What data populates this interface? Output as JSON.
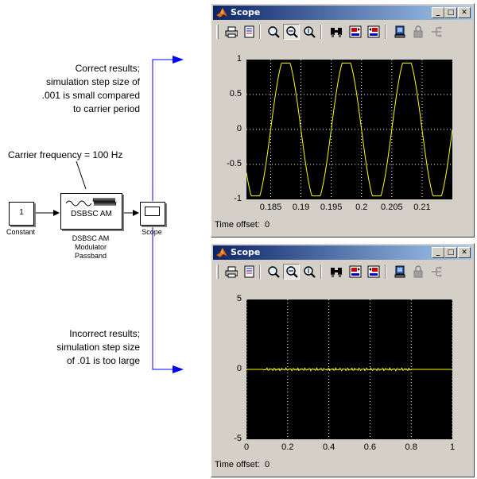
{
  "annotations": {
    "correct": [
      "Correct results;",
      "simulation step size of",
      ".001 is small compared",
      "to carrier period"
    ],
    "carrier": "Carrier frequency = 100 Hz",
    "incorrect": [
      "Incorrect results;",
      "simulation step size",
      "of .01 is too large"
    ]
  },
  "diagram": {
    "constant_value": "1",
    "constant_label": "Constant",
    "modulator_block_text": "DSBSC AM",
    "modulator_label": [
      "DSBSC AM",
      "Modulator",
      "Passband"
    ],
    "scope_label": "Scope"
  },
  "scope_top": {
    "title": "Scope",
    "time_offset_label": "Time offset:",
    "time_offset_value": "0",
    "y_ticks": [
      "1",
      "0.5",
      "0",
      "-0.5",
      "-1"
    ],
    "x_ticks": [
      "0.185",
      "0.19",
      "0.195",
      "0.2",
      "0.205",
      "0.21"
    ]
  },
  "scope_bottom": {
    "title": "Scope",
    "time_offset_label": "Time offset:",
    "time_offset_value": "0",
    "y_ticks": [
      "5",
      "0",
      "-5"
    ],
    "x_ticks": [
      "0",
      "0.2",
      "0.4",
      "0.6",
      "0.8",
      "1"
    ]
  },
  "toolbar_icons": [
    "print-icon",
    "parameters-icon",
    "zoom-icon",
    "zoom-x-icon",
    "zoom-y-icon",
    "autoscale-icon",
    "save-axes-icon",
    "restore-axes-icon",
    "floating-scope-icon",
    "lock-axes-icon",
    "signal-selector-icon"
  ],
  "colors": {
    "trace": "#ffff00",
    "grid": "#ffffff",
    "plot_bg": "#000000",
    "window_bg": "#d4d0c8",
    "arrow": "#0000ff"
  },
  "chart_data": [
    {
      "type": "line",
      "title": "",
      "xlabel": "",
      "ylabel": "",
      "xlim": [
        0.181,
        0.215
      ],
      "ylim": [
        -1,
        1
      ],
      "grid": true,
      "series": [
        {
          "x_start": 0.181,
          "x_end": 0.215,
          "frequency_hz": 100,
          "amplitude": 1,
          "phase": "peaks at 0.1875, 0.1975, 0.2075",
          "style": "clipped sine at ±0.95"
        }
      ]
    },
    {
      "type": "line",
      "title": "",
      "xlabel": "",
      "ylabel": "",
      "xlim": [
        0,
        1
      ],
      "ylim": [
        -5,
        5
      ],
      "grid": true,
      "series": [
        {
          "x": [
            0,
            0.8,
            1
          ],
          "y": [
            0,
            0,
            0
          ],
          "noise_until": 0.8,
          "noise_amplitude": 0.1
        }
      ]
    }
  ]
}
